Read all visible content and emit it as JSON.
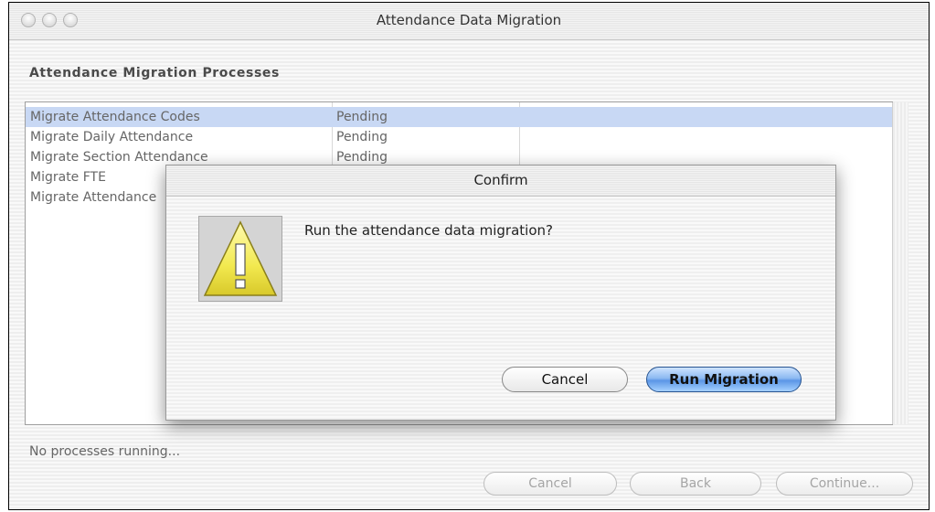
{
  "window": {
    "title": "Attendance Data Migration"
  },
  "section": {
    "heading": "Attendance Migration Processes"
  },
  "processes": [
    {
      "name": "Migrate Attendance Codes",
      "status": "Pending",
      "selected": true
    },
    {
      "name": "Migrate Daily Attendance",
      "status": "Pending",
      "selected": false
    },
    {
      "name": "Migrate Section Attendance",
      "status": "Pending",
      "selected": false
    },
    {
      "name": "Migrate FTE",
      "status": "",
      "selected": false
    },
    {
      "name": "Migrate Attendance",
      "status": "",
      "selected": false
    }
  ],
  "status_bar": {
    "text": "No processes running..."
  },
  "footer_buttons": {
    "cancel": "Cancel",
    "back": "Back",
    "continue": "Continue..."
  },
  "dialog": {
    "title": "Confirm",
    "message": "Run the attendance data migration?",
    "icon": "warning-icon",
    "cancel_label": "Cancel",
    "confirm_label": "Run Migration"
  },
  "colors": {
    "selection": "#c8d8f4",
    "default_button": "#5b96e6",
    "warning_yellow": "#f2e94f"
  }
}
